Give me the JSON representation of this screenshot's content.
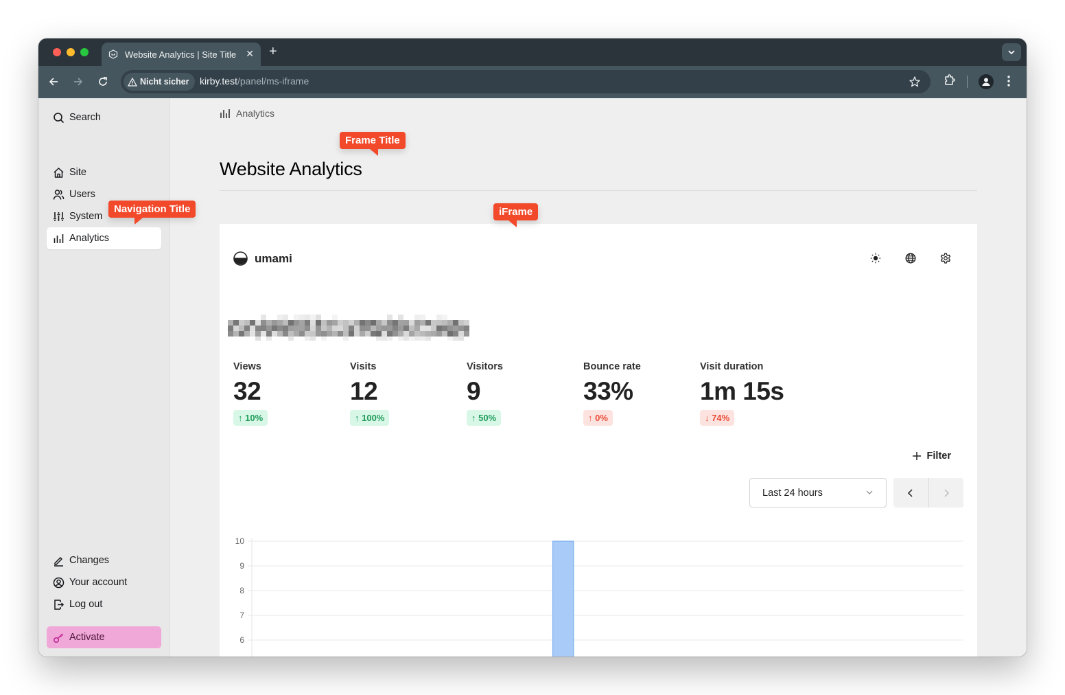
{
  "browser": {
    "tab_title": "Website Analytics | Site Title",
    "tab_close": "✕",
    "new_tab": "+",
    "security_label": "Nicht sicher",
    "url_host": "kirby.test",
    "url_path": "/panel/ms-iframe"
  },
  "sidebar": {
    "search_label": "Search",
    "items": [
      {
        "label": "Site",
        "icon": "home-icon"
      },
      {
        "label": "Users",
        "icon": "users-icon"
      },
      {
        "label": "System",
        "icon": "sliders-icon"
      },
      {
        "label": "Analytics",
        "icon": "bar-chart-icon",
        "active": true
      }
    ],
    "bottom_items": [
      {
        "label": "Changes",
        "icon": "pencil-icon"
      },
      {
        "label": "Your account",
        "icon": "account-icon"
      },
      {
        "label": "Log out",
        "icon": "logout-icon"
      }
    ],
    "activate_label": "Activate",
    "activate_color": "#f0a8d8"
  },
  "main": {
    "breadcrumb": "Analytics",
    "page_title": "Website Analytics"
  },
  "callouts": {
    "frame_title": "Frame Title",
    "navigation_title": "Navigation Title",
    "iframe": "iFrame",
    "color": "#f2492a"
  },
  "umami": {
    "brand": "umami",
    "icons": [
      "sun-icon",
      "globe-icon",
      "gear-icon"
    ],
    "metrics": [
      {
        "label": "Views",
        "value": "32",
        "change": "10%",
        "direction": "up",
        "status": "good"
      },
      {
        "label": "Visits",
        "value": "12",
        "change": "100%",
        "direction": "up",
        "status": "good"
      },
      {
        "label": "Visitors",
        "value": "9",
        "change": "50%",
        "direction": "up",
        "status": "good"
      },
      {
        "label": "Bounce rate",
        "value": "33%",
        "change": "0%",
        "direction": "up",
        "status": "bad"
      },
      {
        "label": "Visit duration",
        "value": "1m 15s",
        "change": "74%",
        "direction": "down",
        "status": "bad"
      }
    ],
    "filter_label": "Filter",
    "date_range": "Last 24 hours"
  },
  "chart_data": {
    "type": "bar",
    "title": "",
    "xlabel": "",
    "ylabel": "",
    "y_ticks_visible": [
      10,
      9,
      8,
      7,
      6
    ],
    "ylim_visible": [
      5.5,
      10
    ],
    "slots": 24,
    "bar_color": "#a9cbf7",
    "bar_border": "#7fb0f0",
    "bars": [
      {
        "slot": 10,
        "value": 10
      }
    ],
    "grid": true
  }
}
